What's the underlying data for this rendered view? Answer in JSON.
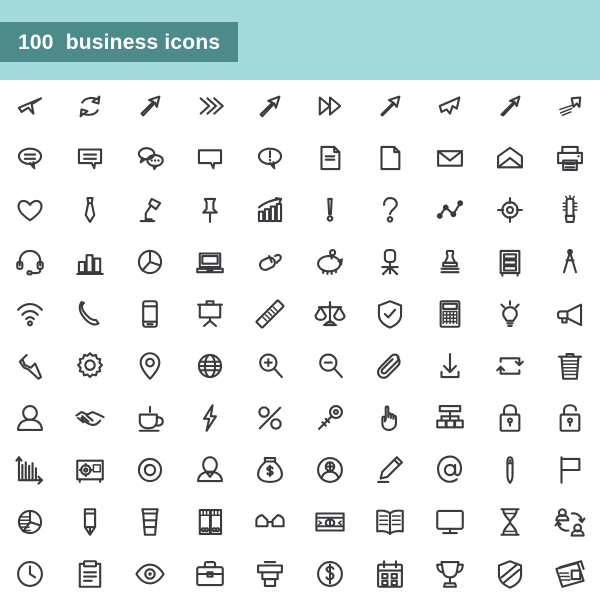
{
  "page": {
    "background_color": "#ffffff",
    "header_band_color": "#a5dadd",
    "title_box_color": "#4d8b8b",
    "title_text_color": "#ffffff",
    "icon_stroke_color": "#3b3b3f"
  },
  "header": {
    "title": "100  business icons",
    "count": "100",
    "subject": "business icons"
  },
  "grid": {
    "columns": 10,
    "rows": 10,
    "total_icons": 100
  },
  "icons": [
    {
      "name": "cursor-arrow-icon",
      "label": "cursor arrow",
      "row": 1,
      "col": 1
    },
    {
      "name": "refresh-sync-icon",
      "label": "refresh sync arrows",
      "row": 1,
      "col": 2
    },
    {
      "name": "arrow-up-right-icon",
      "label": "arrow up right",
      "row": 1,
      "col": 3
    },
    {
      "name": "double-chevron-right-icon",
      "label": "triple chevron right",
      "row": 1,
      "col": 4
    },
    {
      "name": "arrow-up-right-outline-icon",
      "label": "arrow up right outline",
      "row": 1,
      "col": 5
    },
    {
      "name": "fast-forward-icon",
      "label": "fast forward",
      "row": 1,
      "col": 6
    },
    {
      "name": "arrow-up-right-bold-icon",
      "label": "arrow up right bold",
      "row": 1,
      "col": 7
    },
    {
      "name": "cursor-pointer-icon",
      "label": "cursor pointer",
      "row": 1,
      "col": 8
    },
    {
      "name": "arrow-up-right-thin-icon",
      "label": "arrow up right thin",
      "row": 1,
      "col": 9
    },
    {
      "name": "motion-arrow-icon",
      "label": "motion arrow",
      "row": 1,
      "col": 10
    },
    {
      "name": "speech-bubble-lines-icon",
      "label": "speech bubble with lines",
      "row": 2,
      "col": 1
    },
    {
      "name": "chat-box-lines-icon",
      "label": "chat box with lines",
      "row": 2,
      "col": 2
    },
    {
      "name": "chat-bubbles-dots-icon",
      "label": "chat bubbles with dots",
      "row": 2,
      "col": 3
    },
    {
      "name": "speech-bubble-empty-icon",
      "label": "empty speech bubble",
      "row": 2,
      "col": 4
    },
    {
      "name": "alert-bubble-icon",
      "label": "alert speech bubble",
      "row": 2,
      "col": 5
    },
    {
      "name": "document-text-icon",
      "label": "document with text",
      "row": 2,
      "col": 6
    },
    {
      "name": "document-blank-icon",
      "label": "blank document",
      "row": 2,
      "col": 7
    },
    {
      "name": "envelope-closed-icon",
      "label": "closed envelope",
      "row": 2,
      "col": 8
    },
    {
      "name": "envelope-open-icon",
      "label": "open envelope",
      "row": 2,
      "col": 9
    },
    {
      "name": "printer-icon",
      "label": "printer",
      "row": 2,
      "col": 10
    },
    {
      "name": "heart-icon",
      "label": "heart",
      "row": 3,
      "col": 1
    },
    {
      "name": "necktie-icon",
      "label": "necktie",
      "row": 3,
      "col": 2
    },
    {
      "name": "desk-lamp-icon",
      "label": "desk lamp",
      "row": 3,
      "col": 3
    },
    {
      "name": "pushpin-icon",
      "label": "pushpin",
      "row": 3,
      "col": 4
    },
    {
      "name": "growth-chart-icon",
      "label": "growth bar chart with arrow",
      "row": 3,
      "col": 5
    },
    {
      "name": "exclamation-mark-icon",
      "label": "exclamation mark",
      "row": 3,
      "col": 6
    },
    {
      "name": "question-mark-icon",
      "label": "question mark",
      "row": 3,
      "col": 7
    },
    {
      "name": "line-graph-icon",
      "label": "line graph with points",
      "row": 3,
      "col": 8
    },
    {
      "name": "target-crosshair-icon",
      "label": "target crosshair",
      "row": 3,
      "col": 9
    },
    {
      "name": "cactus-icon",
      "label": "cactus plant",
      "row": 3,
      "col": 10
    },
    {
      "name": "headset-icon",
      "label": "headset",
      "row": 4,
      "col": 1
    },
    {
      "name": "bar-chart-icon",
      "label": "bar chart",
      "row": 4,
      "col": 2
    },
    {
      "name": "pie-chart-icon",
      "label": "pie chart",
      "row": 4,
      "col": 3
    },
    {
      "name": "laptop-icon",
      "label": "laptop",
      "row": 4,
      "col": 4
    },
    {
      "name": "computer-mouse-icon",
      "label": "computer mouse",
      "row": 4,
      "col": 5
    },
    {
      "name": "piggy-bank-icon",
      "label": "piggy bank",
      "row": 4,
      "col": 6
    },
    {
      "name": "office-chair-icon",
      "label": "office chair",
      "row": 4,
      "col": 7
    },
    {
      "name": "stamp-icon",
      "label": "rubber stamp",
      "row": 4,
      "col": 8
    },
    {
      "name": "filing-cabinet-icon",
      "label": "filing cabinet",
      "row": 4,
      "col": 9
    },
    {
      "name": "compass-divider-icon",
      "label": "drawing compass",
      "row": 4,
      "col": 10
    },
    {
      "name": "wifi-icon",
      "label": "wifi signal",
      "row": 5,
      "col": 1
    },
    {
      "name": "telephone-handset-icon",
      "label": "telephone handset",
      "row": 5,
      "col": 2
    },
    {
      "name": "smartphone-icon",
      "label": "smartphone",
      "row": 5,
      "col": 3
    },
    {
      "name": "presentation-board-icon",
      "label": "presentation board",
      "row": 5,
      "col": 4
    },
    {
      "name": "ruler-icon",
      "label": "ruler",
      "row": 5,
      "col": 5
    },
    {
      "name": "scales-justice-icon",
      "label": "scales of justice",
      "row": 5,
      "col": 6
    },
    {
      "name": "shield-check-icon",
      "label": "shield with checkmark",
      "row": 5,
      "col": 7
    },
    {
      "name": "calculator-icon",
      "label": "calculator",
      "row": 5,
      "col": 8
    },
    {
      "name": "lightbulb-icon",
      "label": "lightbulb",
      "row": 5,
      "col": 9
    },
    {
      "name": "megaphone-icon",
      "label": "megaphone",
      "row": 5,
      "col": 10
    },
    {
      "name": "wrench-icon",
      "label": "wrench",
      "row": 6,
      "col": 1
    },
    {
      "name": "gear-icon",
      "label": "gear",
      "row": 6,
      "col": 2
    },
    {
      "name": "map-pin-icon",
      "label": "map pin",
      "row": 6,
      "col": 3
    },
    {
      "name": "globe-icon",
      "label": "globe",
      "row": 6,
      "col": 4
    },
    {
      "name": "zoom-in-icon",
      "label": "magnifier zoom in",
      "row": 6,
      "col": 5
    },
    {
      "name": "zoom-out-icon",
      "label": "magnifier zoom out",
      "row": 6,
      "col": 6
    },
    {
      "name": "paperclip-icon",
      "label": "paperclip",
      "row": 6,
      "col": 7
    },
    {
      "name": "download-icon",
      "label": "download arrow",
      "row": 6,
      "col": 8
    },
    {
      "name": "loop-repeat-icon",
      "label": "loop repeat arrows",
      "row": 6,
      "col": 9
    },
    {
      "name": "trash-bin-icon",
      "label": "trash bin",
      "row": 6,
      "col": 10
    },
    {
      "name": "user-icon",
      "label": "user person",
      "row": 7,
      "col": 1
    },
    {
      "name": "handshake-icon",
      "label": "handshake",
      "row": 7,
      "col": 2
    },
    {
      "name": "coffee-cup-icon",
      "label": "coffee cup",
      "row": 7,
      "col": 3
    },
    {
      "name": "lightning-bolt-icon",
      "label": "lightning bolt",
      "row": 7,
      "col": 4
    },
    {
      "name": "percent-icon",
      "label": "percent sign",
      "row": 7,
      "col": 5
    },
    {
      "name": "key-icon",
      "label": "key",
      "row": 7,
      "col": 6
    },
    {
      "name": "pointing-hand-icon",
      "label": "pointing hand",
      "row": 7,
      "col": 7
    },
    {
      "name": "org-chart-icon",
      "label": "organization hierarchy chart",
      "row": 7,
      "col": 8
    },
    {
      "name": "lock-closed-icon",
      "label": "closed padlock",
      "row": 7,
      "col": 9
    },
    {
      "name": "lock-open-icon",
      "label": "open padlock",
      "row": 7,
      "col": 10
    },
    {
      "name": "bar-graph-axes-icon",
      "label": "bar graph with axes",
      "row": 8,
      "col": 1
    },
    {
      "name": "safe-vault-icon",
      "label": "safe vault",
      "row": 8,
      "col": 2
    },
    {
      "name": "donut-chart-icon",
      "label": "donut chart",
      "row": 8,
      "col": 3
    },
    {
      "name": "avatar-icon",
      "label": "person avatar",
      "row": 8,
      "col": 4
    },
    {
      "name": "money-bag-icon",
      "label": "money bag",
      "row": 8,
      "col": 5
    },
    {
      "name": "add-user-icon",
      "label": "add user circle",
      "row": 8,
      "col": 6
    },
    {
      "name": "pencil-edit-icon",
      "label": "pencil edit",
      "row": 8,
      "col": 7
    },
    {
      "name": "at-sign-icon",
      "label": "at sign",
      "row": 8,
      "col": 8
    },
    {
      "name": "pen-icon",
      "label": "pen",
      "row": 8,
      "col": 9
    },
    {
      "name": "flag-icon",
      "label": "flag",
      "row": 8,
      "col": 10
    },
    {
      "name": "striped-pie-chart-icon",
      "label": "striped pie chart",
      "row": 9,
      "col": 1
    },
    {
      "name": "pencil-icon",
      "label": "pencil",
      "row": 9,
      "col": 2
    },
    {
      "name": "coffee-togo-icon",
      "label": "coffee to go cup",
      "row": 9,
      "col": 3
    },
    {
      "name": "binders-icon",
      "label": "binders folders",
      "row": 9,
      "col": 4
    },
    {
      "name": "eyeglasses-icon",
      "label": "eyeglasses",
      "row": 9,
      "col": 5
    },
    {
      "name": "banknote-icon",
      "label": "dollar banknote",
      "row": 9,
      "col": 6
    },
    {
      "name": "open-book-icon",
      "label": "open book",
      "row": 9,
      "col": 7
    },
    {
      "name": "monitor-icon",
      "label": "computer monitor",
      "row": 9,
      "col": 8
    },
    {
      "name": "hourglass-icon",
      "label": "hourglass",
      "row": 9,
      "col": 9
    },
    {
      "name": "user-exchange-icon",
      "label": "user exchange arrows",
      "row": 9,
      "col": 10
    },
    {
      "name": "clock-icon",
      "label": "clock",
      "row": 10,
      "col": 1
    },
    {
      "name": "clipboard-icon",
      "label": "clipboard",
      "row": 10,
      "col": 2
    },
    {
      "name": "eye-icon",
      "label": "eye",
      "row": 10,
      "col": 3
    },
    {
      "name": "briefcase-icon",
      "label": "briefcase",
      "row": 10,
      "col": 4
    },
    {
      "name": "card-slot-icon",
      "label": "atm card slot",
      "row": 10,
      "col": 5
    },
    {
      "name": "dollar-coin-icon",
      "label": "dollar coin",
      "row": 10,
      "col": 6
    },
    {
      "name": "calendar-icon",
      "label": "calendar",
      "row": 10,
      "col": 7
    },
    {
      "name": "trophy-icon",
      "label": "trophy",
      "row": 10,
      "col": 8
    },
    {
      "name": "shield-stripes-icon",
      "label": "striped shield",
      "row": 10,
      "col": 9
    },
    {
      "name": "newspaper-icon",
      "label": "newspaper",
      "row": 10,
      "col": 10
    }
  ]
}
